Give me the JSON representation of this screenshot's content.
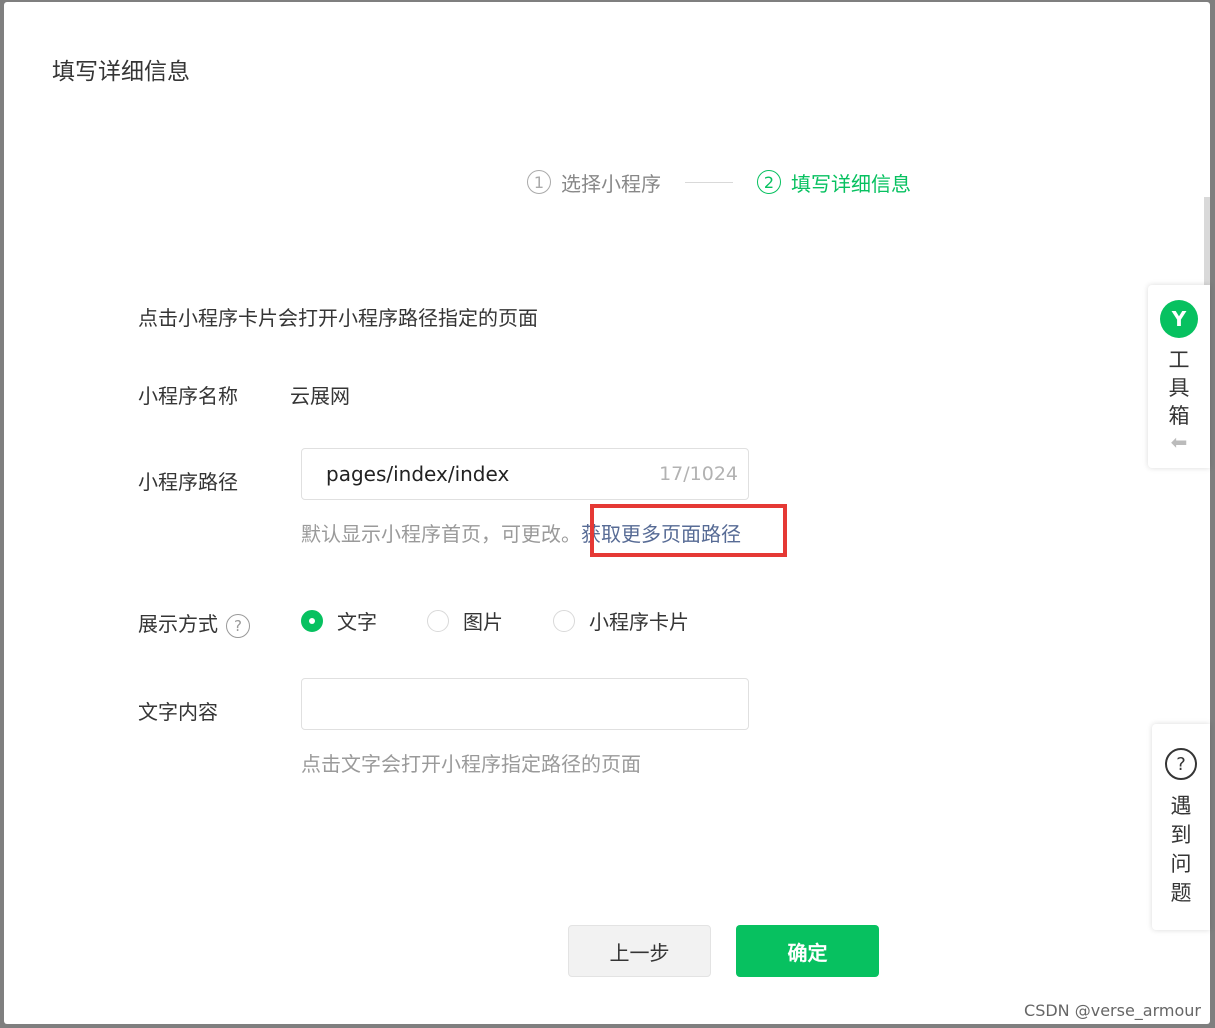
{
  "dialog": {
    "title": "填写详细信息"
  },
  "steps": [
    {
      "number": "1",
      "label": "选择小程序"
    },
    {
      "number": "2",
      "label": "填写详细信息"
    }
  ],
  "form": {
    "intro": "点击小程序卡片会打开小程序路径指定的页面",
    "name_label": "小程序名称",
    "name_value": "云展网",
    "path_label": "小程序路径",
    "path_value": "pages/index/index",
    "path_counter": "17/1024",
    "path_hint": "默认显示小程序首页，可更改。",
    "path_more_link": "获取更多页面路径",
    "display_label": "展示方式",
    "display_help_icon": "?",
    "display_options": [
      "文字",
      "图片",
      "小程序卡片"
    ],
    "display_selected": "文字",
    "text_label": "文字内容",
    "text_value": "",
    "text_hint": "点击文字会打开小程序指定路径的页面"
  },
  "buttons": {
    "prev": "上一步",
    "confirm": "确定"
  },
  "side_panel": {
    "toolbox_logo": "Y",
    "toolbox_label": "工具箱",
    "toolbox_arrow": "⬅",
    "issue_icon": "?",
    "issue_label": "遇到问题"
  },
  "watermark": "CSDN @verse_armour",
  "colors": {
    "accent": "#07c160",
    "link": "#576b95",
    "highlight": "#e53935"
  }
}
